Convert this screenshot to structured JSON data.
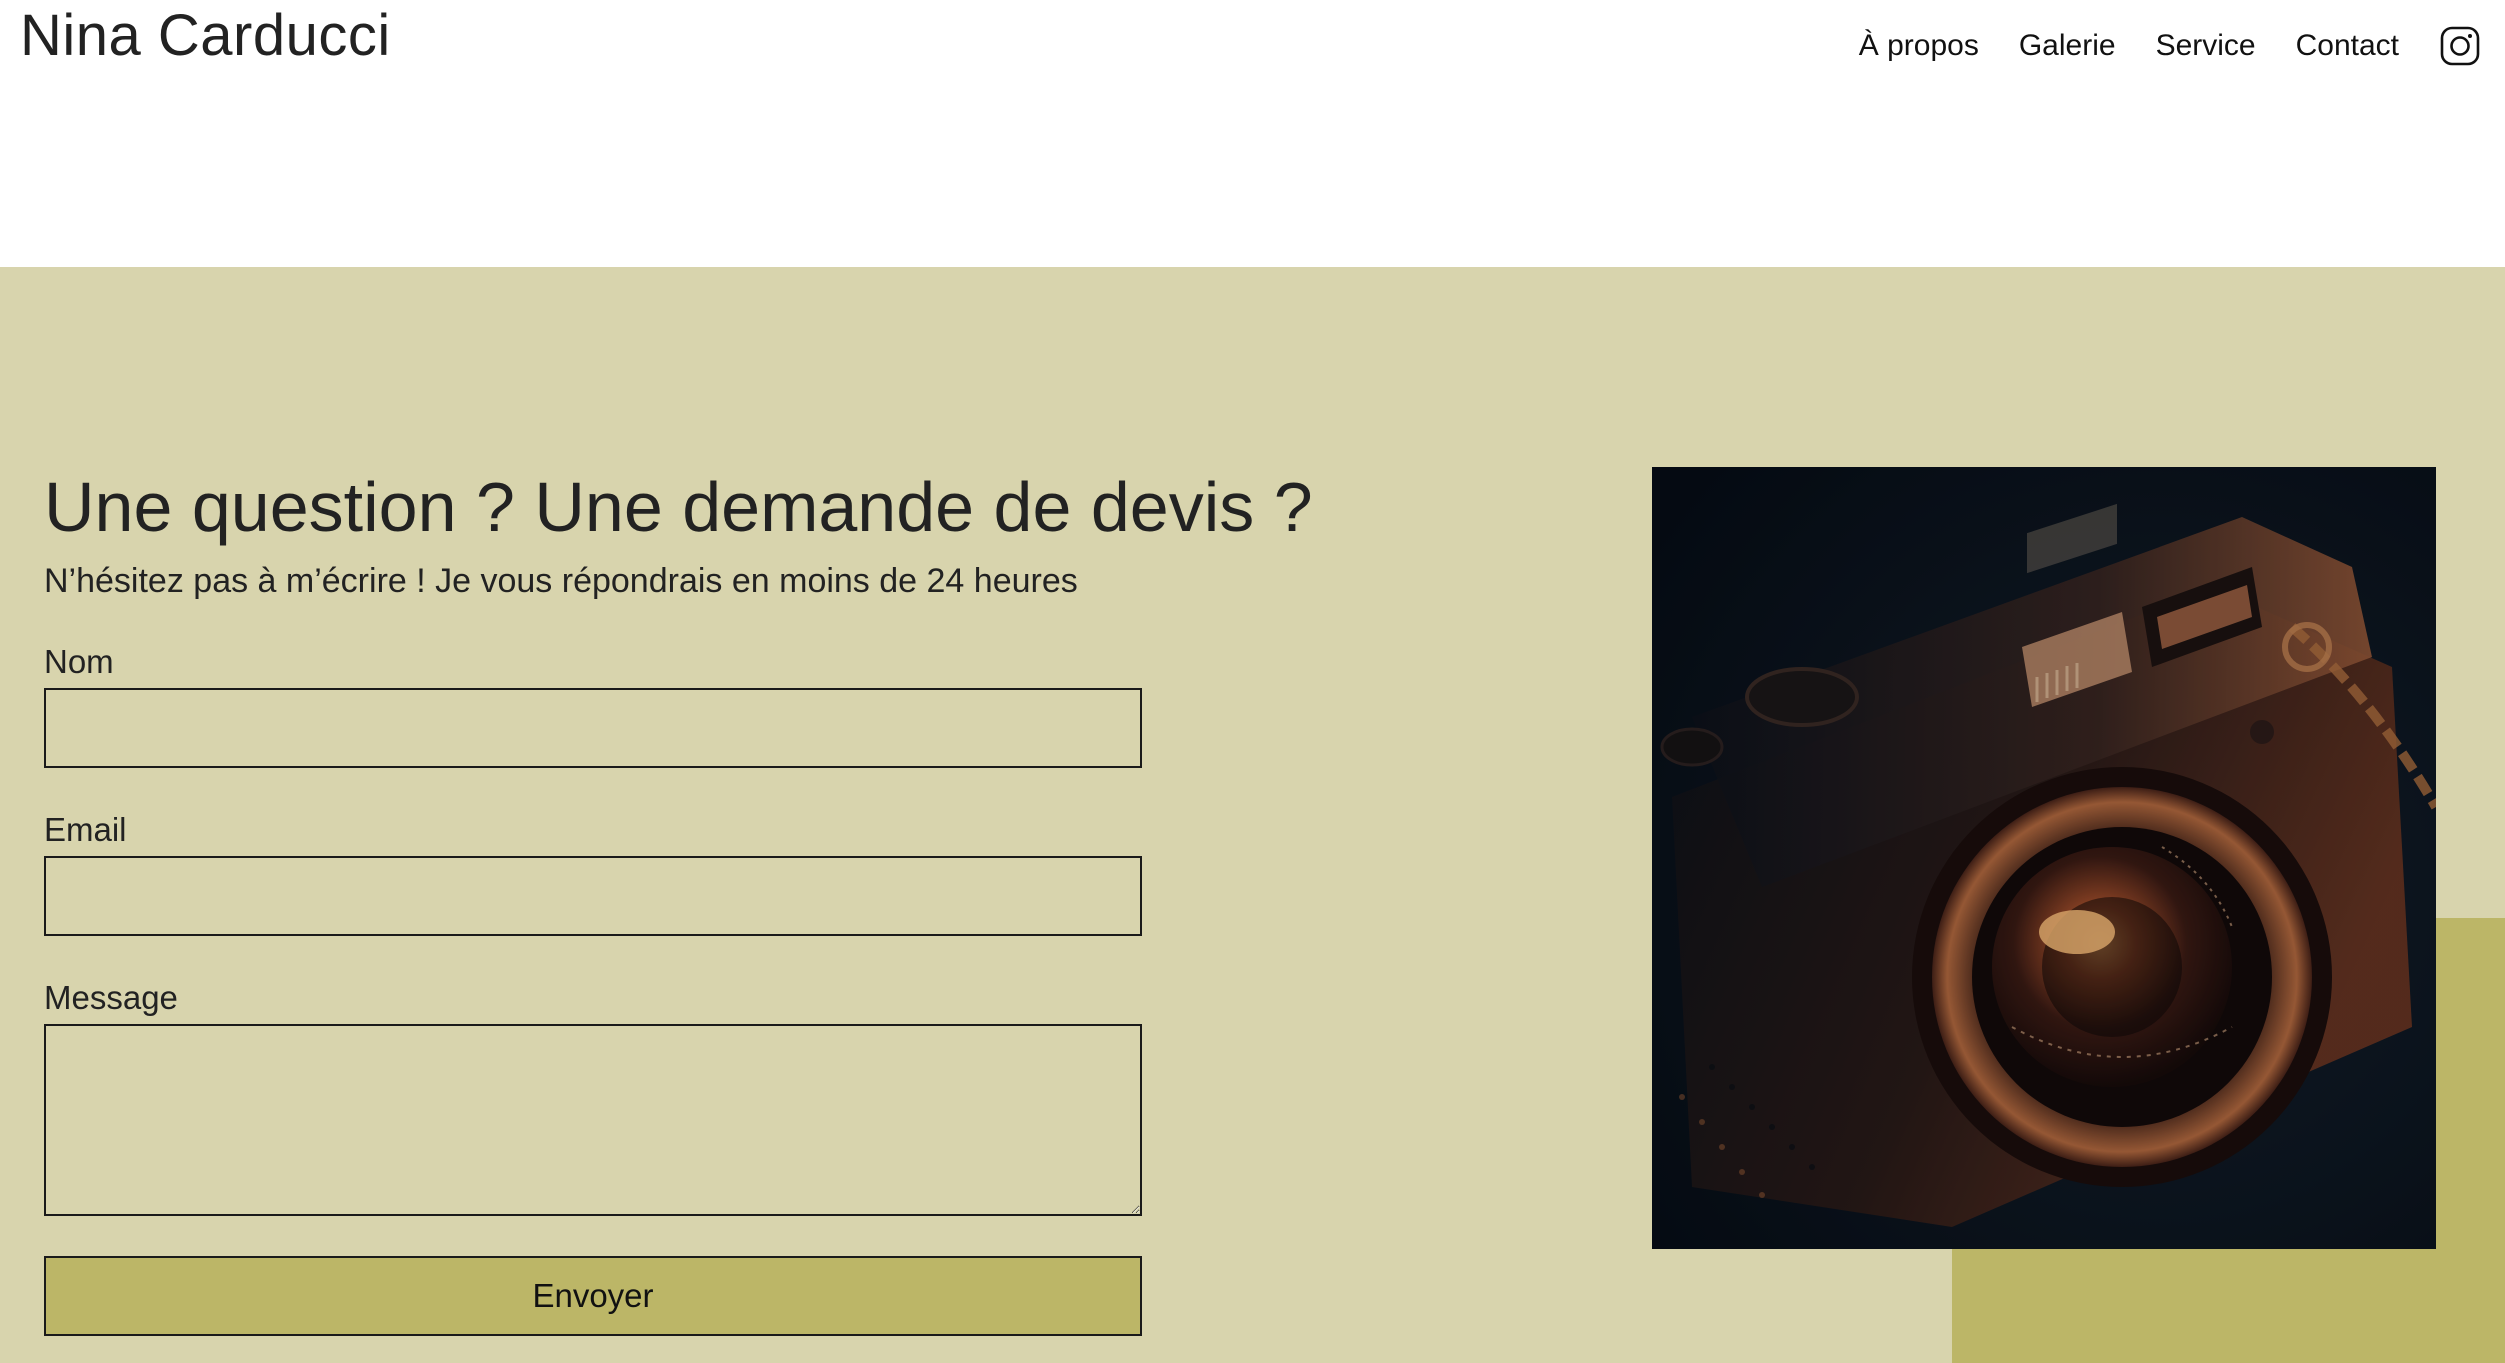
{
  "header": {
    "brand": "Nina Carducci",
    "nav": [
      "À propos",
      "Galerie",
      "Service",
      "Contact"
    ],
    "social_icon": "instagram-icon"
  },
  "contact": {
    "title": "Une question ? Une demande de devis ?",
    "subtitle": "N’hésitez pas à m’écrire ! Je vous répondrais en moins de 24 heures",
    "fields": {
      "name_label": "Nom",
      "name_value": "",
      "email_label": "Email",
      "email_value": "",
      "message_label": "Message",
      "message_value": ""
    },
    "submit_label": "Envoyer",
    "image_alt": "camera photo"
  },
  "colors": {
    "section_bg": "#d8d4ad",
    "accent": "#bcb667",
    "text": "#222222"
  }
}
